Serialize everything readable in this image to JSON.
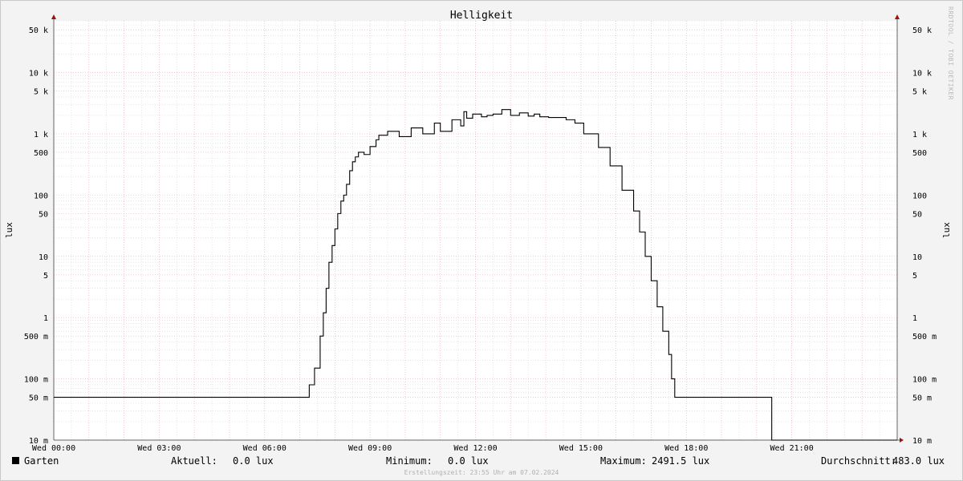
{
  "watermark": "RRDTOOL / TOBI OETIKER",
  "legend": {
    "series_name": "Garten",
    "current_label": "Aktuell:",
    "current_value": "0.0 lux",
    "min_label": "Minimum:",
    "min_value": "0.0 lux",
    "max_label": "Maximum:",
    "max_value": "2491.5 lux",
    "avg_label": "Durchschnitt:",
    "avg_value": "483.0 lux"
  },
  "footer": "Erstellungszeit: 23:55 Uhr am 07.02.2024",
  "colors": {
    "series": "#000000",
    "major_grid": "#e8a8b0",
    "minor_grid": "#d6d6d6",
    "arrow": "#a01010"
  },
  "chart_data": {
    "type": "line",
    "title": "Helligkeit",
    "ylabel": "lux",
    "xlabel": "",
    "x_unit": "hours",
    "xlim": [
      0,
      24
    ],
    "ylim": [
      0.01,
      70000
    ],
    "yscale": "log",
    "grid": true,
    "x_ticks": [
      {
        "x": 0,
        "label": "Wed 00:00"
      },
      {
        "x": 3,
        "label": "Wed 03:00"
      },
      {
        "x": 6,
        "label": "Wed 06:00"
      },
      {
        "x": 9,
        "label": "Wed 09:00"
      },
      {
        "x": 12,
        "label": "Wed 12:00"
      },
      {
        "x": 15,
        "label": "Wed 15:00"
      },
      {
        "x": 18,
        "label": "Wed 18:00"
      },
      {
        "x": 21,
        "label": "Wed 21:00"
      }
    ],
    "y_ticks": [
      {
        "y": 50000,
        "label": "50 k"
      },
      {
        "y": 10000,
        "label": "10 k"
      },
      {
        "y": 5000,
        "label": "5 k"
      },
      {
        "y": 1000,
        "label": "1 k"
      },
      {
        "y": 500,
        "label": "500"
      },
      {
        "y": 100,
        "label": "100"
      },
      {
        "y": 50,
        "label": "50"
      },
      {
        "y": 10,
        "label": "10"
      },
      {
        "y": 5,
        "label": "5"
      },
      {
        "y": 1,
        "label": "1"
      },
      {
        "y": 0.5,
        "label": "500 m"
      },
      {
        "y": 0.1,
        "label": "100 m"
      },
      {
        "y": 0.05,
        "label": "50 m"
      },
      {
        "y": 0.01,
        "label": "10 m"
      }
    ],
    "series": [
      {
        "name": "Garten",
        "x": [
          0,
          7.27,
          7.42,
          7.58,
          7.67,
          7.75,
          7.83,
          7.92,
          8.0,
          8.08,
          8.17,
          8.25,
          8.33,
          8.42,
          8.5,
          8.58,
          8.67,
          8.83,
          9.0,
          9.17,
          9.25,
          9.5,
          9.83,
          10.17,
          10.5,
          10.83,
          11.0,
          11.33,
          11.58,
          11.67,
          11.75,
          11.92,
          12.17,
          12.33,
          12.5,
          12.75,
          13.0,
          13.25,
          13.5,
          13.67,
          13.83,
          14.08,
          14.33,
          14.58,
          14.83,
          15.08,
          15.5,
          15.83,
          16.17,
          16.5,
          16.67,
          16.83,
          17.0,
          17.17,
          17.33,
          17.5,
          17.58,
          17.67,
          17.75,
          17.83,
          17.92,
          18.0,
          18.08,
          18.17,
          18.25,
          18.33,
          20.42,
          20.43,
          24.0
        ],
        "y": [
          0.05,
          0.08,
          0.15,
          0.5,
          1.2,
          3,
          8,
          15,
          28,
          50,
          80,
          100,
          150,
          250,
          350,
          420,
          500,
          460,
          620,
          800,
          950,
          1100,
          900,
          1250,
          1000,
          1500,
          1100,
          1700,
          1350,
          2300,
          1800,
          2100,
          1900,
          2000,
          2100,
          2491.5,
          2000,
          2200,
          1950,
          2100,
          1900,
          1850,
          1850,
          1700,
          1500,
          1000,
          600,
          300,
          120,
          55,
          25,
          10,
          4,
          1.5,
          0.6,
          0.25,
          0.1,
          0.05,
          0.05,
          0.05,
          0.05,
          0.05,
          0.05,
          0.05,
          0.05,
          0.05,
          0.05,
          0.01,
          0.01
        ]
      }
    ]
  }
}
